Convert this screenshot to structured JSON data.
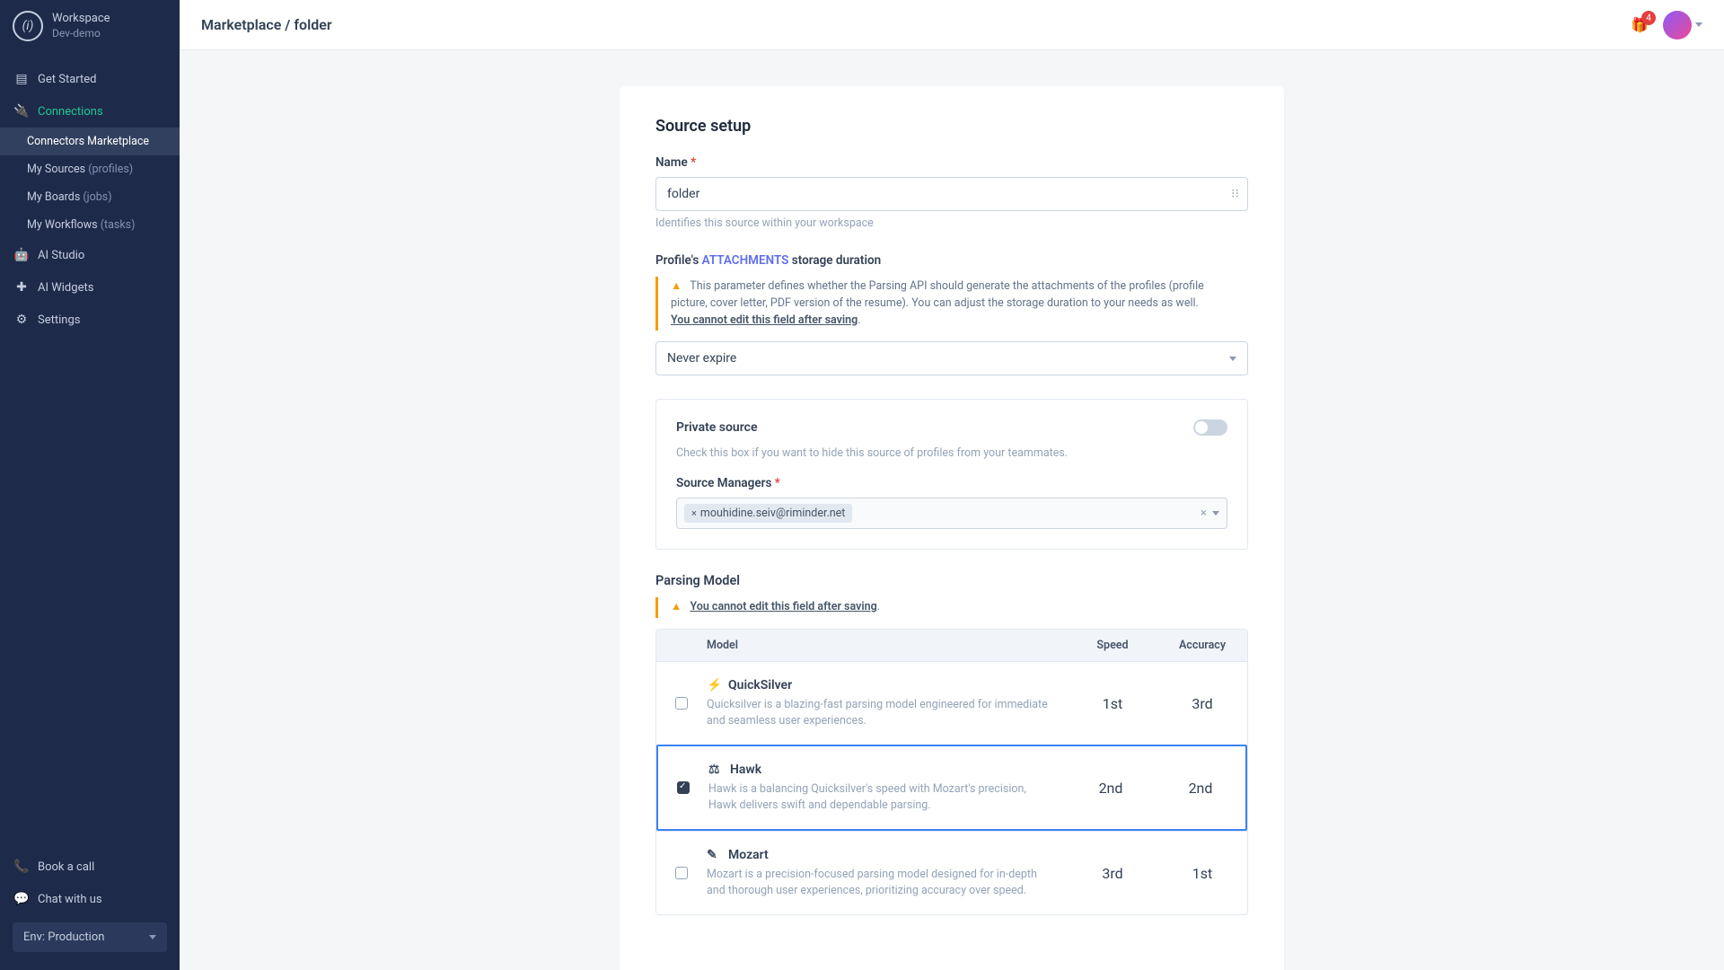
{
  "workspace": {
    "label": "Workspace",
    "name": "Dev-demo"
  },
  "sidebar": {
    "items": [
      {
        "label": "Get Started"
      },
      {
        "label": "Connections"
      },
      {
        "label": "AI Studio"
      },
      {
        "label": "AI Widgets"
      },
      {
        "label": "Settings"
      }
    ],
    "conn_sub": [
      {
        "label": "Connectors Marketplace"
      },
      {
        "label": "My Sources ",
        "suffix": "(profiles)"
      },
      {
        "label": "My Boards ",
        "suffix": "(jobs)"
      },
      {
        "label": "My Workflows ",
        "suffix": "(tasks)"
      }
    ],
    "bottom": [
      {
        "label": "Book a call"
      },
      {
        "label": "Chat with us"
      }
    ],
    "env": "Env: Production"
  },
  "topbar": {
    "breadcrumb": "Marketplace / folder",
    "gift_badge": "4"
  },
  "form": {
    "title": "Source setup",
    "name_label": "Name",
    "name_value": "folder",
    "name_hint": "Identifies this source within your workspace",
    "attach_prefix": "Profile's ",
    "attach_link": "ATTACHMENTS",
    "attach_suffix": " storage duration",
    "attach_warn": "This parameter defines whether the Parsing API should generate the attachments of the profiles (profile picture, cover letter, PDF version of the resume). You can adjust the storage duration to your needs as well.",
    "attach_warn_u": "You cannot edit this field after saving",
    "expire_value": "Never expire",
    "private_title": "Private source",
    "private_hint": "Check this box if you want to hide this source of profiles from your teammates.",
    "managers_label": "Source Managers",
    "manager_tag": "mouhidine.seiv@riminder.net",
    "parsing_title": "Parsing Model",
    "parsing_warn": "You cannot edit this field after saving",
    "table": {
      "h_model": "Model",
      "h_speed": "Speed",
      "h_acc": "Accuracy",
      "rows": [
        {
          "name": "QuickSilver",
          "desc": "Quicksilver is a blazing-fast parsing model engineered for immediate and seamless user experiences.",
          "speed": "1st",
          "acc": "3rd",
          "selected": false
        },
        {
          "name": "Hawk",
          "desc": "Hawk is a balancing Quicksilver's speed with Mozart's precision, Hawk delivers swift and dependable parsing.",
          "speed": "2nd",
          "acc": "2nd",
          "selected": true
        },
        {
          "name": "Mozart",
          "desc": "Mozart is a precision-focused parsing model designed for in-depth and thorough user experiences, prioritizing accuracy over speed.",
          "speed": "3rd",
          "acc": "1st",
          "selected": false
        }
      ]
    }
  }
}
